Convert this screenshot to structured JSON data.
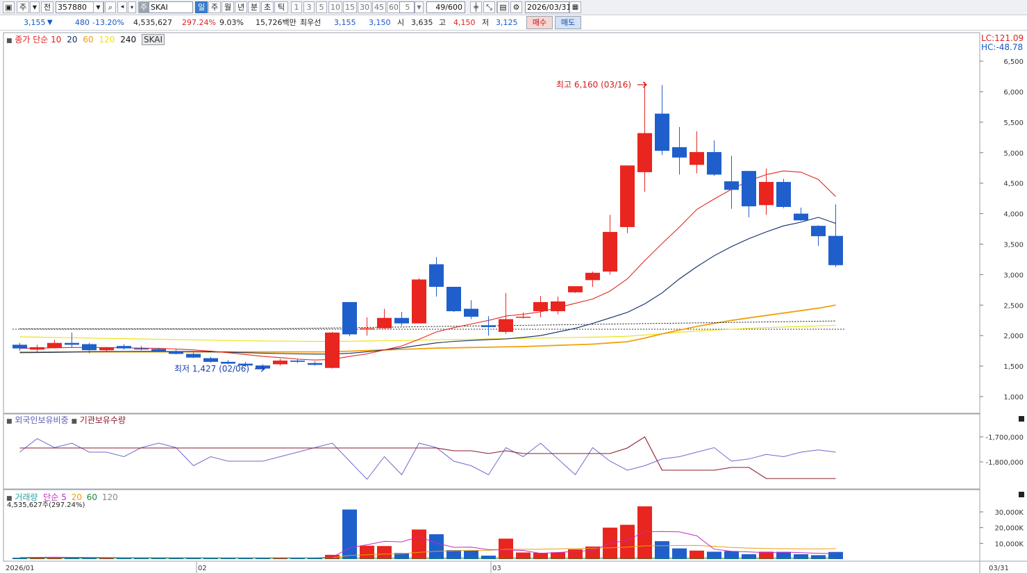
{
  "toolbar": {
    "market_label": "주",
    "type_label": "전",
    "code": "357880",
    "name": "SKAI",
    "name_prefix": "주",
    "periods": [
      "일",
      "주",
      "월",
      "년",
      "분",
      "초",
      "틱"
    ],
    "active_period": "일",
    "intervals": [
      "1",
      "3",
      "5",
      "10",
      "15",
      "30",
      "45",
      "60"
    ],
    "interval_value": "5",
    "count": "49/600",
    "date": "2026/03/31"
  },
  "quote": {
    "price": "3,155",
    "change_arrow": "▼",
    "change": "480",
    "change_pct": "-13.20%",
    "volume": "4,535,627",
    "volume_pct": "297.24%",
    "turnover_pct": "9.03%",
    "amount": "15,726백만",
    "best_label": "최우선",
    "best_ask": "3,155",
    "best_bid": "3,150",
    "open_label": "시",
    "open": "3,635",
    "high_label": "고",
    "high": "4,150",
    "low_label": "저",
    "low": "3,125",
    "buy_label": "매수",
    "sell_label": "매도"
  },
  "main_panel": {
    "legend": {
      "prefix": "종가 단순",
      "periods": [
        "10",
        "20",
        "60",
        "120",
        "240"
      ],
      "symbol": "SKAI"
    },
    "lc_label": "LC:121.09",
    "hc_label": "HC:-48.78",
    "max_note": "최고 6,160 (03/16)",
    "min_note": "최저 1,427 (02/06)",
    "y_ticks": [
      6500,
      6000,
      5500,
      5000,
      4500,
      4000,
      3500,
      3000,
      2500,
      2000,
      1500,
      1000
    ]
  },
  "holding_panel": {
    "label_foreign": "외국인보유비중",
    "label_inst": "기관보유수량",
    "y_ticks": [
      "-1,700,000",
      "-1,800,000"
    ]
  },
  "volume_panel": {
    "label": "거래량",
    "ma_prefix": "단순",
    "ma_periods": [
      "5",
      "20",
      "60",
      "120"
    ],
    "current": "4,535,627주(297.24%)",
    "y_ticks": [
      "30,000K",
      "20,000K",
      "10,000K"
    ]
  },
  "x_axis": {
    "labels": [
      "2026/01",
      "02",
      "03"
    ],
    "right_label": "03/31"
  },
  "colors": {
    "up": "#e8251f",
    "down": "#1f5fcc",
    "ma10": "#e8251f",
    "ma20": "#0b2a66",
    "ma60": "#f0a10a",
    "ma120": "#ece21a",
    "ma240": "#111111"
  },
  "chart_data": {
    "type": "candlestick",
    "candles": [
      {
        "o": 1850,
        "h": 1880,
        "l": 1750,
        "c": 1790
      },
      {
        "o": 1770,
        "h": 1850,
        "l": 1720,
        "c": 1810
      },
      {
        "o": 1800,
        "h": 1930,
        "l": 1790,
        "c": 1880
      },
      {
        "o": 1880,
        "h": 2050,
        "l": 1810,
        "c": 1850
      },
      {
        "o": 1860,
        "h": 1880,
        "l": 1710,
        "c": 1760
      },
      {
        "o": 1760,
        "h": 1810,
        "l": 1730,
        "c": 1800
      },
      {
        "o": 1830,
        "h": 1860,
        "l": 1770,
        "c": 1790
      },
      {
        "o": 1790,
        "h": 1830,
        "l": 1760,
        "c": 1780
      },
      {
        "o": 1780,
        "h": 1800,
        "l": 1730,
        "c": 1740
      },
      {
        "o": 1740,
        "h": 1770,
        "l": 1690,
        "c": 1700
      },
      {
        "o": 1700,
        "h": 1720,
        "l": 1630,
        "c": 1640
      },
      {
        "o": 1630,
        "h": 1650,
        "l": 1560,
        "c": 1570
      },
      {
        "o": 1570,
        "h": 1600,
        "l": 1530,
        "c": 1540
      },
      {
        "o": 1540,
        "h": 1570,
        "l": 1490,
        "c": 1510
      },
      {
        "o": 1510,
        "h": 1530,
        "l": 1427,
        "c": 1460
      },
      {
        "o": 1530,
        "h": 1620,
        "l": 1510,
        "c": 1590
      },
      {
        "o": 1590,
        "h": 1620,
        "l": 1550,
        "c": 1570
      },
      {
        "o": 1550,
        "h": 1580,
        "l": 1510,
        "c": 1520
      },
      {
        "o": 1470,
        "h": 2060,
        "l": 1460,
        "c": 2050
      },
      {
        "o": 2550,
        "h": 2550,
        "l": 1990,
        "c": 2020
      },
      {
        "o": 2100,
        "h": 2300,
        "l": 2000,
        "c": 2120
      },
      {
        "o": 2120,
        "h": 2440,
        "l": 2110,
        "c": 2290
      },
      {
        "o": 2290,
        "h": 2390,
        "l": 2160,
        "c": 2200
      },
      {
        "o": 2200,
        "h": 2940,
        "l": 2200,
        "c": 2920
      },
      {
        "o": 3170,
        "h": 3290,
        "l": 2640,
        "c": 2800
      },
      {
        "o": 2800,
        "h": 2800,
        "l": 2390,
        "c": 2400
      },
      {
        "o": 2440,
        "h": 2580,
        "l": 2270,
        "c": 2310
      },
      {
        "o": 2170,
        "h": 2320,
        "l": 2000,
        "c": 2140
      },
      {
        "o": 2060,
        "h": 2700,
        "l": 2030,
        "c": 2270
      },
      {
        "o": 2300,
        "h": 2380,
        "l": 2280,
        "c": 2310
      },
      {
        "o": 2400,
        "h": 2650,
        "l": 2300,
        "c": 2550
      },
      {
        "o": 2400,
        "h": 2640,
        "l": 2350,
        "c": 2560
      },
      {
        "o": 2710,
        "h": 2800,
        "l": 2700,
        "c": 2810
      },
      {
        "o": 2910,
        "h": 3050,
        "l": 2800,
        "c": 3030
      },
      {
        "o": 3050,
        "h": 3980,
        "l": 3000,
        "c": 3700
      },
      {
        "o": 3780,
        "h": 4780,
        "l": 3680,
        "c": 4790
      },
      {
        "o": 4680,
        "h": 6160,
        "l": 4360,
        "c": 5320
      },
      {
        "o": 5640,
        "h": 6110,
        "l": 4960,
        "c": 5030
      },
      {
        "o": 5090,
        "h": 5420,
        "l": 4640,
        "c": 4920
      },
      {
        "o": 4800,
        "h": 5350,
        "l": 4660,
        "c": 5010
      },
      {
        "o": 5010,
        "h": 5200,
        "l": 4620,
        "c": 4640
      },
      {
        "o": 4530,
        "h": 4950,
        "l": 4080,
        "c": 4390
      },
      {
        "o": 4700,
        "h": 4700,
        "l": 3940,
        "c": 4120
      },
      {
        "o": 4140,
        "h": 4740,
        "l": 3980,
        "c": 4520
      },
      {
        "o": 4520,
        "h": 4570,
        "l": 4090,
        "c": 4110
      },
      {
        "o": 4000,
        "h": 4100,
        "l": 3880,
        "c": 3890
      },
      {
        "o": 3800,
        "h": 3810,
        "l": 3470,
        "c": 3630
      },
      {
        "o": 3635,
        "h": 4150,
        "l": 3125,
        "c": 3155
      }
    ],
    "ma10": [
      1790,
      1795,
      1800,
      1805,
      1805,
      1805,
      1800,
      1795,
      1790,
      1780,
      1765,
      1745,
      1720,
      1690,
      1660,
      1640,
      1615,
      1600,
      1610,
      1660,
      1700,
      1765,
      1830,
      1940,
      2060,
      2130,
      2190,
      2250,
      2320,
      2350,
      2390,
      2460,
      2530,
      2600,
      2730,
      2930,
      3230,
      3510,
      3780,
      4070,
      4240,
      4400,
      4540,
      4640,
      4700,
      4680,
      4560,
      4280
    ],
    "ma20": [
      1720,
      1722,
      1725,
      1730,
      1735,
      1738,
      1740,
      1742,
      1742,
      1740,
      1738,
      1733,
      1728,
      1720,
      1712,
      1706,
      1701,
      1697,
      1697,
      1710,
      1735,
      1765,
      1800,
      1840,
      1880,
      1905,
      1920,
      1935,
      1945,
      1970,
      2000,
      2060,
      2120,
      2200,
      2290,
      2380,
      2520,
      2700,
      2930,
      3130,
      3310,
      3460,
      3590,
      3700,
      3800,
      3860,
      3940,
      3840
    ],
    "ma60": [
      1730,
      1731,
      1732,
      1733,
      1733,
      1733,
      1733,
      1733,
      1733,
      1733,
      1733,
      1733,
      1732,
      1732,
      1732,
      1732,
      1732,
      1732,
      1735,
      1745,
      1755,
      1765,
      1775,
      1785,
      1795,
      1800,
      1805,
      1810,
      1815,
      1820,
      1830,
      1840,
      1850,
      1860,
      1880,
      1900,
      1960,
      2030,
      2090,
      2150,
      2200,
      2250,
      2290,
      2330,
      2370,
      2410,
      2450,
      2500
    ],
    "ma120": [
      1980,
      1975,
      1970,
      1965,
      1960,
      1955,
      1950,
      1945,
      1940,
      1935,
      1930,
      1925,
      1920,
      1915,
      1912,
      1910,
      1908,
      1906,
      1906,
      1908,
      1912,
      1915,
      1920,
      1925,
      1930,
      1935,
      1940,
      1945,
      1950,
      1955,
      1960,
      1965,
      1970,
      1975,
      1980,
      1990,
      2010,
      2030,
      2055,
      2075,
      2090,
      2105,
      2120,
      2130,
      2140,
      2150,
      2160,
      2170
    ],
    "ma240_start": 2110,
    "ma240_end": 2240,
    "foreign_ratio": [
      0.4,
      0.1,
      0.3,
      0.2,
      0.4,
      0.4,
      0.5,
      0.3,
      0.2,
      0.3,
      0.7,
      0.5,
      0.6,
      0.6,
      0.6,
      0.5,
      0.4,
      0.3,
      0.2,
      0.6,
      1.0,
      0.5,
      0.9,
      0.2,
      0.3,
      0.6,
      0.7,
      0.9,
      0.3,
      0.5,
      0.2,
      0.55,
      0.9,
      0.3,
      0.6,
      0.8,
      0.7,
      0.55,
      0.5,
      0.4,
      0.3,
      0.6,
      0.55,
      0.45,
      0.5,
      0.4,
      0.35,
      0.4
    ],
    "inst_holding": [
      0.6,
      0.6,
      0.6,
      0.6,
      0.6,
      0.6,
      0.6,
      0.6,
      0.6,
      0.6,
      0.6,
      0.6,
      0.6,
      0.6,
      0.6,
      0.6,
      0.6,
      0.6,
      0.6,
      0.6,
      0.6,
      0.6,
      0.6,
      0.6,
      0.6,
      0.55,
      0.55,
      0.5,
      0.55,
      0.5,
      0.5,
      0.5,
      0.5,
      0.5,
      0.5,
      0.6,
      0.8,
      0.2,
      0.2,
      0.2,
      0.2,
      0.25,
      0.25,
      0.05,
      0.05,
      0.05,
      0.05,
      0.05
    ],
    "volume": [
      900,
      1000,
      1300,
      900,
      800,
      800,
      800,
      700,
      700,
      700,
      700,
      700,
      700,
      700,
      700,
      700,
      700,
      700,
      2700,
      31500,
      8500,
      8300,
      3900,
      18800,
      15800,
      5700,
      5500,
      2200,
      13000,
      4200,
      4000,
      4300,
      6200,
      8000,
      20000,
      21800,
      33500,
      11400,
      6800,
      5400,
      4700,
      5100,
      3100,
      4700,
      4600,
      3100,
      2500,
      4535
    ],
    "vol_ma5": [
      1000,
      1100,
      1200,
      1100,
      1000,
      900,
      850,
      800,
      780,
      760,
      740,
      720,
      700,
      700,
      700,
      700,
      700,
      700,
      1100,
      7200,
      9100,
      11300,
      11000,
      14200,
      10200,
      7500,
      7600,
      6000,
      5800,
      5500,
      3600,
      4200,
      4900,
      5500,
      10000,
      12000,
      17400,
      17500,
      17300,
      14800,
      6300,
      5000,
      4600,
      4100,
      4400,
      4100,
      3700,
      3500
    ],
    "vol_ma20": [
      900,
      900,
      950,
      950,
      950,
      950,
      900,
      900,
      850,
      850,
      850,
      800,
      800,
      800,
      800,
      800,
      800,
      800,
      900,
      2400,
      2800,
      3200,
      3400,
      4300,
      5000,
      5300,
      5500,
      5600,
      6200,
      6200,
      6300,
      6500,
      6700,
      6900,
      7200,
      7600,
      8400,
      8500,
      8600,
      8700,
      8100,
      7400,
      7000,
      6700,
      6600,
      6500,
      6500,
      6600
    ]
  }
}
